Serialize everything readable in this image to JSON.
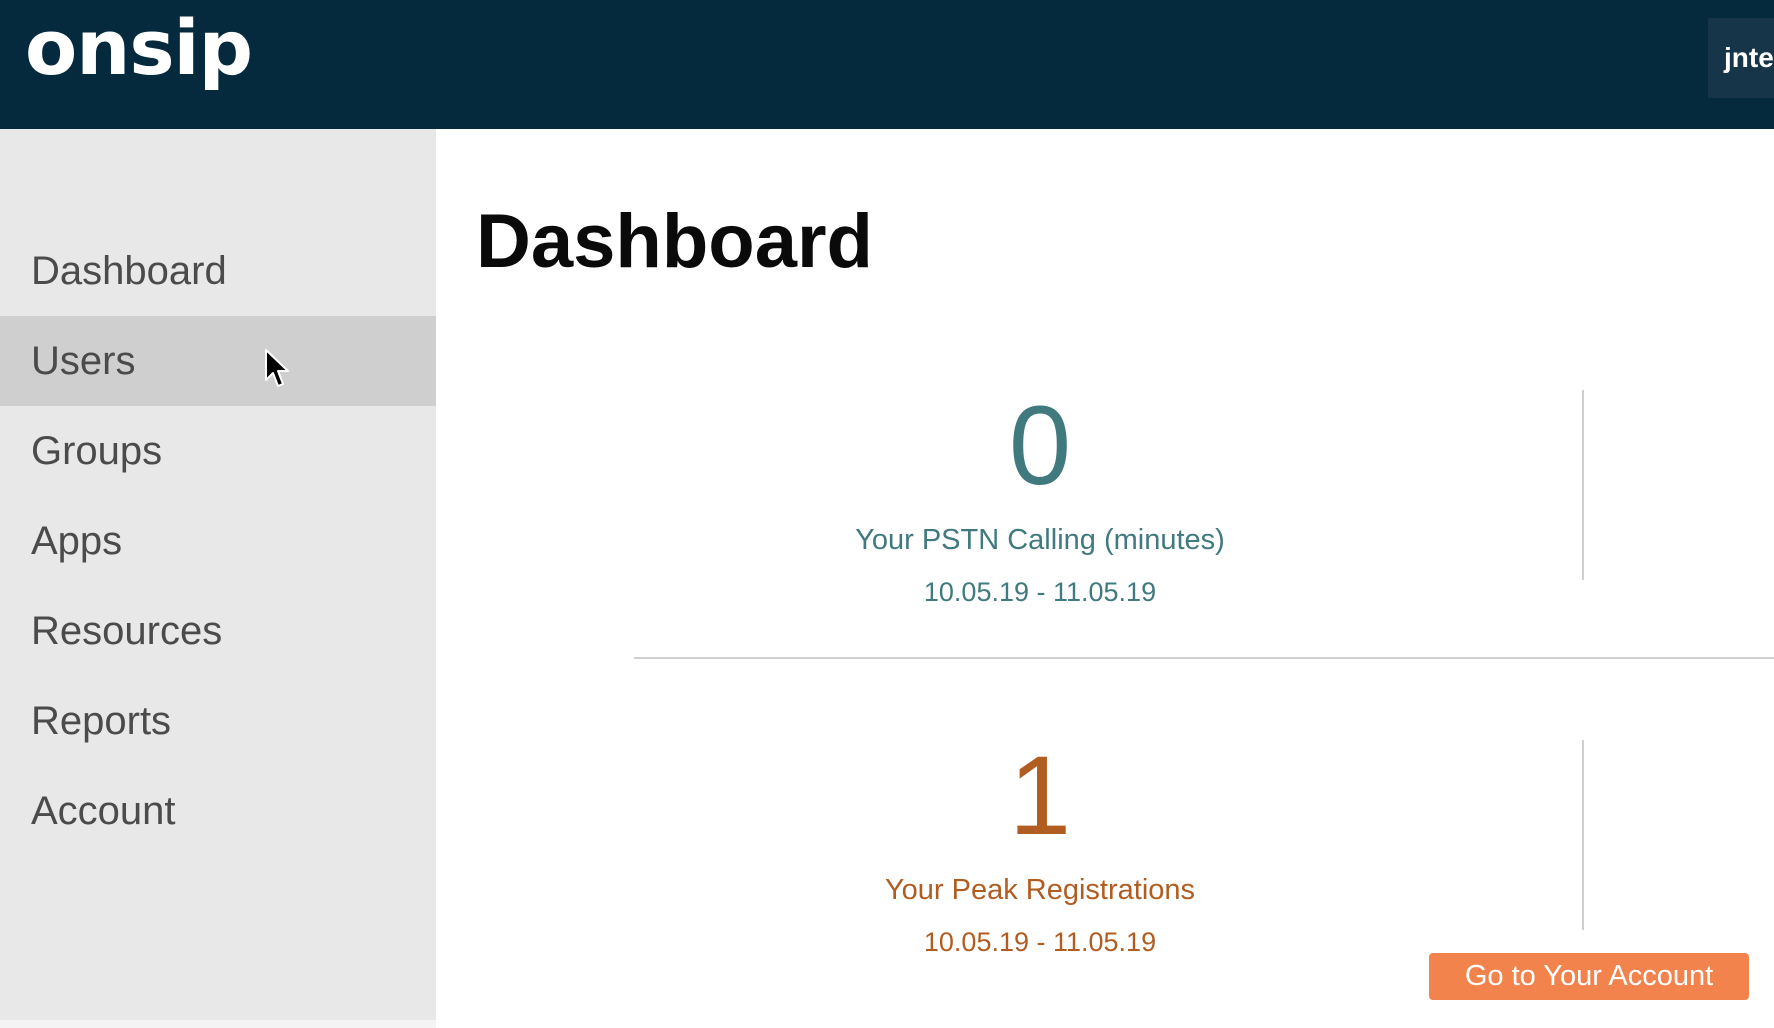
{
  "header": {
    "logo_text": "onsip",
    "user_label": "jnte"
  },
  "sidebar": {
    "items": [
      {
        "label": "Dashboard"
      },
      {
        "label": "Users"
      },
      {
        "label": "Groups"
      },
      {
        "label": "Apps"
      },
      {
        "label": "Resources"
      },
      {
        "label": "Reports"
      },
      {
        "label": "Account"
      }
    ]
  },
  "main": {
    "title": "Dashboard",
    "stats": [
      {
        "value": "0",
        "label": "Your PSTN Calling (minutes)",
        "range": "10.05.19 - 11.05.19",
        "color": "#417a7e"
      },
      {
        "value": "1",
        "label": "Your Peak Registrations",
        "range": "10.05.19 - 11.05.19",
        "color": "#b15d22"
      }
    ],
    "cta_label": "Go to Your Account"
  },
  "colors": {
    "header_bg": "#05293d",
    "sidebar_bg": "#e8e8e8",
    "sidebar_hover": "#cfcfcf",
    "cta_bg": "#f3834d"
  }
}
